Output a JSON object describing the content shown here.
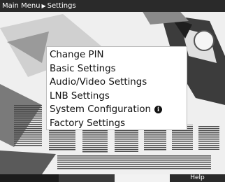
{
  "header": {
    "crumb_root": "Main Menu",
    "crumb_current": "Settings"
  },
  "menu": {
    "items": [
      {
        "label": "Change PIN"
      },
      {
        "label": "Basic Settings"
      },
      {
        "label": "Audio/Video Settings"
      },
      {
        "label": "LNB Settings"
      },
      {
        "label": "System Configuration",
        "info_icon": "info-icon"
      },
      {
        "label": "Factory Settings"
      }
    ],
    "selected_index": 0
  },
  "footer": {
    "red_label": "",
    "green_label": "",
    "yellow_label": "",
    "blue_label": "Help"
  },
  "background": {
    "brand_text": "MARTINA ERTL",
    "tagline": "SKI - WELTWEITE FAHRT"
  },
  "colors": {
    "header_bg": "#2a2a2a",
    "menu_bg": "#ffffff",
    "text": "#111111"
  }
}
